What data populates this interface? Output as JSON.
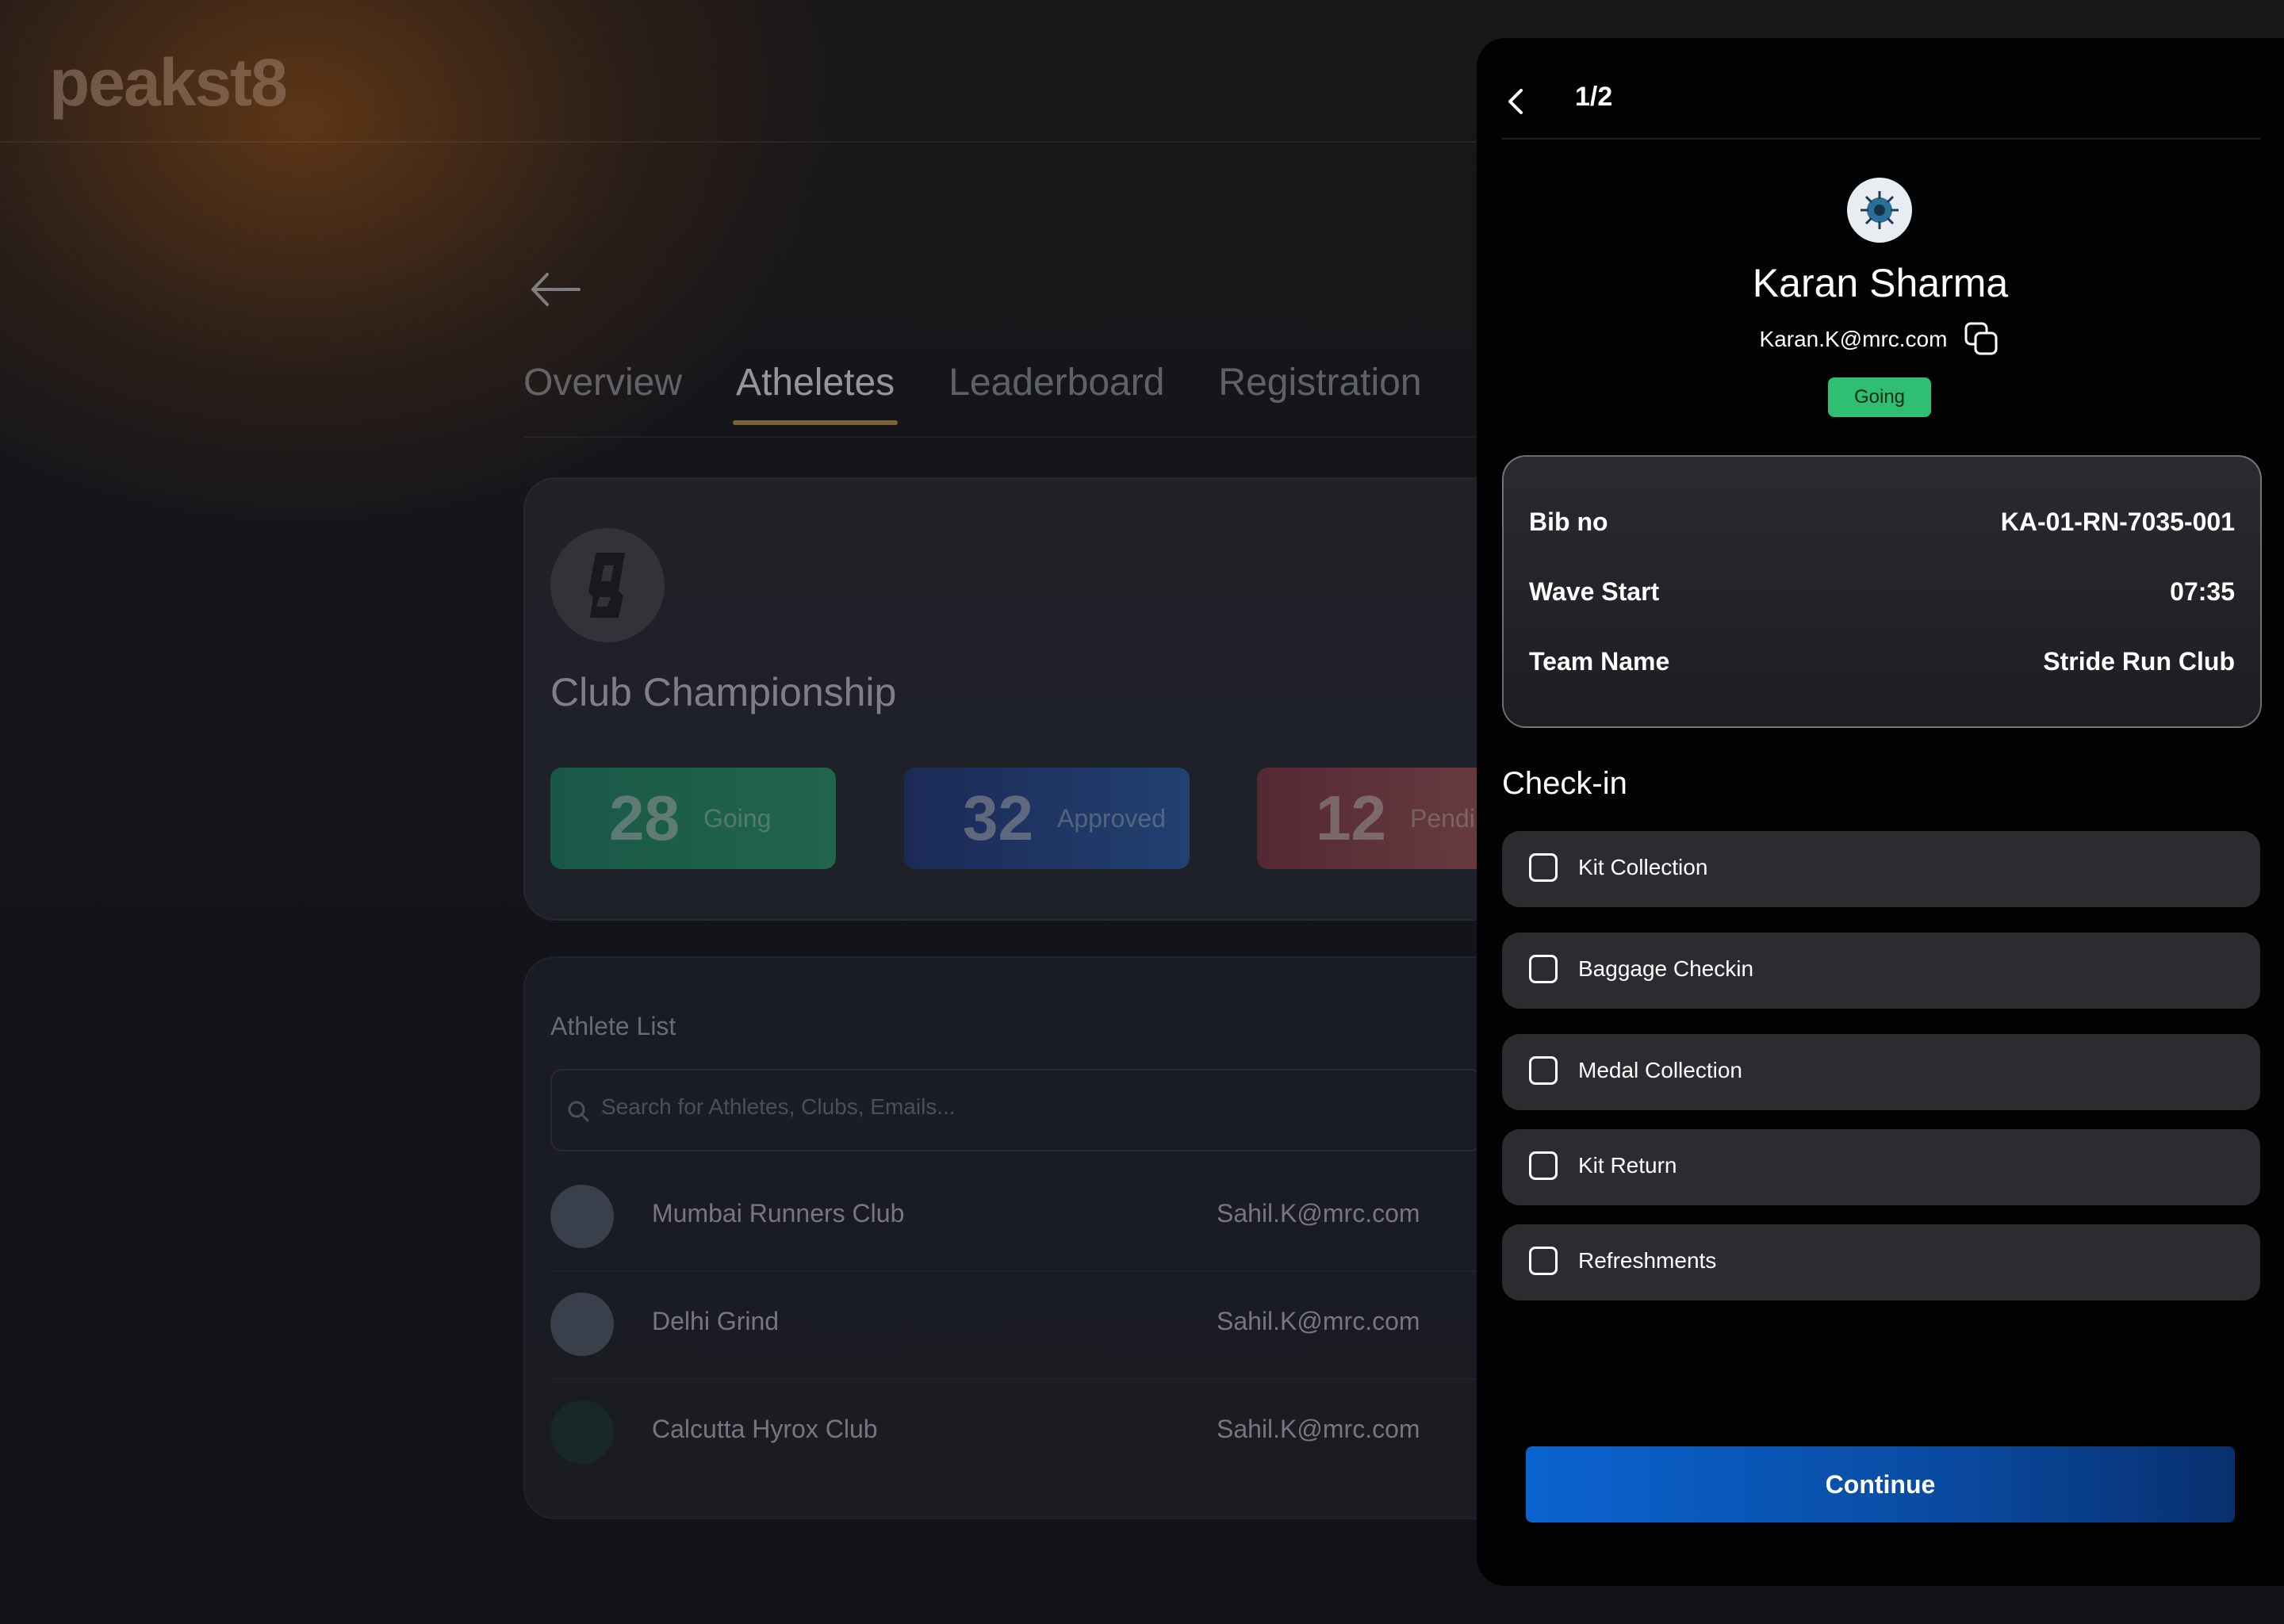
{
  "brand": {
    "logo_text": "peakst8"
  },
  "event": {
    "tabs": [
      {
        "label": "Overview"
      },
      {
        "label": "Atheletes"
      },
      {
        "label": "Leaderboard"
      },
      {
        "label": "Registration"
      }
    ],
    "title": "Club Championship",
    "stats": [
      {
        "value": "28",
        "label": "Going"
      },
      {
        "value": "32",
        "label": "Approved"
      },
      {
        "value": "12",
        "label": "Pendin"
      }
    ]
  },
  "athlete_list": {
    "title": "Athlete List",
    "search_placeholder": "Search for Athletes, Clubs, Emails...",
    "rows": [
      {
        "name": "Mumbai Runners Club",
        "email": "Sahil.K@mrc.com"
      },
      {
        "name": "Delhi Grind",
        "email": "Sahil.K@mrc.com"
      },
      {
        "name": "Calcutta Hyrox Club",
        "email": "Sahil.K@mrc.com"
      }
    ]
  },
  "drawer": {
    "pager": "1/2",
    "name": "Karan Sharma",
    "email": "Karan.K@mrc.com",
    "status": "Going",
    "details": [
      {
        "label": "Bib no",
        "value": "KA-01-RN-7035-001"
      },
      {
        "label": "Wave Start",
        "value": "07:35"
      },
      {
        "label": "Team Name",
        "value": "Stride Run Club"
      }
    ],
    "checkin_title": "Check-in",
    "checkin_items": [
      {
        "label": "Kit Collection"
      },
      {
        "label": "Baggage Checkin"
      },
      {
        "label": "Medal Collection"
      },
      {
        "label": "Kit Return"
      },
      {
        "label": "Refreshments"
      }
    ],
    "continue_label": "Continue"
  }
}
